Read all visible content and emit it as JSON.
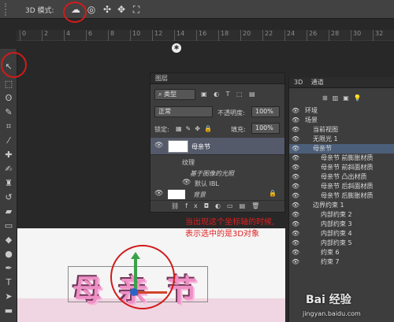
{
  "options_bar": {
    "mode_label": "3D 模式:",
    "mode_icons": [
      "rotate-3d-icon",
      "roll-3d-icon",
      "drag-3d-icon",
      "slide-3d-icon",
      "scale-3d-icon"
    ]
  },
  "ruler": {
    "ticks": [
      "0",
      "2",
      "4",
      "6",
      "8",
      "10",
      "12",
      "14",
      "16",
      "18",
      "20",
      "22",
      "24",
      "26",
      "28",
      "30",
      "32"
    ]
  },
  "canvas": {
    "title_chars": [
      "母",
      "亲",
      "节"
    ],
    "annotation": [
      "当出现这个坐标轴的时候,",
      "表示选中的是3D对象"
    ]
  },
  "layers_panel": {
    "title": "图层",
    "filter_label": "类型",
    "blend_mode": "正常",
    "opacity_label": "不透明度:",
    "opacity_value": "100%",
    "lock_label": "锁定:",
    "fill_label": "填充:",
    "fill_value": "100%",
    "layers": [
      {
        "name": "母亲节",
        "kind": "3d"
      },
      {
        "name": "纹理",
        "kind": "sub"
      },
      {
        "name": "基于图像的光照",
        "kind": "sub-italic"
      },
      {
        "name": "默认 IBL",
        "kind": "sub2"
      },
      {
        "name": "背景",
        "kind": "background"
      }
    ]
  },
  "panel_3d": {
    "tabs": [
      "3D",
      "通道"
    ],
    "items": [
      {
        "label": "环境",
        "indent": 0,
        "selected": false
      },
      {
        "label": "场景",
        "indent": 0,
        "selected": false
      },
      {
        "label": "当前视图",
        "indent": 1,
        "selected": false
      },
      {
        "label": "无限光 1",
        "indent": 1,
        "selected": false
      },
      {
        "label": "母亲节",
        "indent": 1,
        "selected": true
      },
      {
        "label": "母亲节 前膨胀材质",
        "indent": 2,
        "selected": false
      },
      {
        "label": "母亲节 前斜面材质",
        "indent": 2,
        "selected": false
      },
      {
        "label": "母亲节 凸出材质",
        "indent": 2,
        "selected": false
      },
      {
        "label": "母亲节 后斜面材质",
        "indent": 2,
        "selected": false
      },
      {
        "label": "母亲节 后膨胀材质",
        "indent": 2,
        "selected": false
      },
      {
        "label": "边界约束 1",
        "indent": 1,
        "selected": false
      },
      {
        "label": "内部约束 2",
        "indent": 2,
        "selected": false
      },
      {
        "label": "内部约束 3",
        "indent": 2,
        "selected": false
      },
      {
        "label": "内部约束 4",
        "indent": 2,
        "selected": false
      },
      {
        "label": "内部约束 5",
        "indent": 2,
        "selected": false
      },
      {
        "label": "约束 6",
        "indent": 2,
        "selected": false
      },
      {
        "label": "约束 7",
        "indent": 2,
        "selected": false
      }
    ]
  },
  "watermark": {
    "text": "Bai 经验",
    "url": "jingyan.baidu.com"
  },
  "colors": {
    "highlight_red": "#d21b1b",
    "canvas_pink": "#ee8fc6",
    "selected_row": "#4c5f7a"
  }
}
